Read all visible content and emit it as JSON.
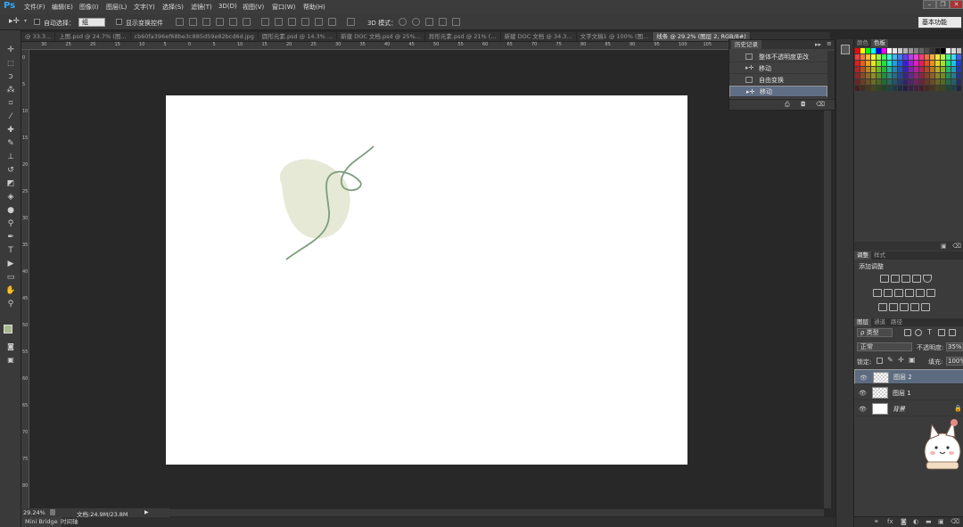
{
  "app": {
    "logo": "Ps"
  },
  "menu": [
    "文件(F)",
    "编辑(E)",
    "图像(I)",
    "图层(L)",
    "文字(Y)",
    "选择(S)",
    "滤镜(T)",
    "3D(D)",
    "视图(V)",
    "窗口(W)",
    "帮助(H)"
  ],
  "window_controls": [
    "–",
    "❐",
    "✕"
  ],
  "options": {
    "auto_select_label": "自动选择：",
    "auto_select_value": "组",
    "show_transform_label": "显示变换控件",
    "mode_3d_label": "3D 模式：",
    "workspace": "基本功能"
  },
  "tabs": [
    {
      "label": "@ 33.3...",
      "active": false
    },
    {
      "label": "上图.psd @ 24.7% (图...",
      "active": false
    },
    {
      "label": "cb60fa396ef68be3c885d59e82bcd6d.jpg",
      "active": false
    },
    {
      "label": "圆形元素.psd @ 14.3% ...",
      "active": false
    },
    {
      "label": "新建 DOC 文档.psd @ 25%...",
      "active": false
    },
    {
      "label": "异形元素.psd @ 21% (...",
      "active": false
    },
    {
      "label": "新建 DOC 文档 @ 34.3...",
      "active": false
    },
    {
      "label": "文字文稿1 @ 100% (图...",
      "active": false
    },
    {
      "label": "线条 @ 29.2% (图层 2, RGB/8#)",
      "active": true
    }
  ],
  "ruler_top": [
    "30",
    "25",
    "20",
    "15",
    "10",
    "5",
    "0",
    "5",
    "10",
    "15",
    "20",
    "25",
    "30",
    "35",
    "40",
    "45",
    "50",
    "55",
    "60",
    "65",
    "70",
    "75",
    "80",
    "85",
    "90",
    "95",
    "100",
    "105",
    "110",
    "115",
    "120",
    "125",
    "130"
  ],
  "ruler_left": [
    "0",
    "5",
    "10",
    "15",
    "20",
    "25",
    "30",
    "35",
    "40",
    "45",
    "50",
    "55",
    "60",
    "65",
    "70",
    "75",
    "80"
  ],
  "history": {
    "tab": "历史记录",
    "items": [
      {
        "label": "整体不透明度更改",
        "selected": false
      },
      {
        "label": "移动",
        "selected": false
      },
      {
        "label": "自由变换",
        "selected": false
      },
      {
        "label": "移动",
        "selected": true
      }
    ]
  },
  "right_panels": {
    "color_tabs": [
      "颜色",
      "色板"
    ],
    "adjust_tabs": [
      "调整",
      "样式"
    ],
    "adjust_title": "添加调整",
    "layer_tabs": [
      "图层",
      "通道",
      "路径"
    ],
    "kind_filter": "ρ 类型",
    "blend_mode": "正常",
    "opacity_label": "不透明度:",
    "opacity_value": "35%",
    "lock_label": "锁定:",
    "fill_label": "填充:",
    "fill_value": "100%"
  },
  "layers": [
    {
      "name": "图层 2",
      "selected": true,
      "thumb": "transparent"
    },
    {
      "name": "图层 1",
      "selected": false,
      "thumb": "transparent"
    },
    {
      "name": "背景",
      "selected": false,
      "thumb": "white",
      "locked": true
    }
  ],
  "status": {
    "zoom": "29.24%",
    "doc": "文档:24.9M/23.8M"
  },
  "bottom_tabs": [
    "Mini Bridge",
    "时间轴"
  ],
  "colors": {
    "foreground": "#a9b98c",
    "background": "#ffffff",
    "shape_fill": "#e6e9d6",
    "stroke": "#7d9e7e"
  }
}
